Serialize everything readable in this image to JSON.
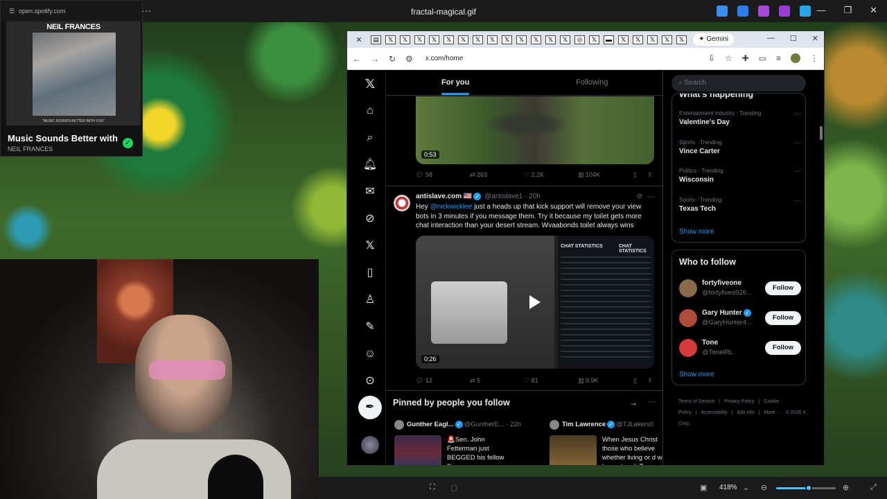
{
  "viewer": {
    "title": "fractal-magical.gif",
    "more": "···",
    "controls": [
      "—",
      "❐",
      "✕"
    ],
    "tray_colors": [
      "#3b8df0",
      "#2b7de9",
      "#a84ad8",
      "#9b3bd6",
      "#2aa4e8"
    ],
    "zoom": "418%"
  },
  "spotify": {
    "url": "open.spotify.com",
    "album_artist_art": "NEIL FRANCES",
    "album_caption": "\"MUSIC SOUNDS BETTER WITH YOU\"",
    "track_title": "Music Sounds Better with",
    "artist": "NEIL FRANCES"
  },
  "browser": {
    "url": "x.com/home",
    "gemini_label": "Gemini",
    "tab_close": "✕",
    "new_tab": "+",
    "tab_count": 22
  },
  "x": {
    "tabs": {
      "for_you": "For you",
      "following": "Following"
    },
    "post1": {
      "video_time": "0:53",
      "replies": "58",
      "reposts": "263",
      "likes": "2.2K",
      "views": "104K"
    },
    "post2": {
      "name": "antislave.com 🇺🇸",
      "handle": "@antislave1",
      "time": "· 20h",
      "text_before": "Hey ",
      "mention": "@nickwicklee",
      "text_after": " just a heads up that kick support will remove your view bots in 3 minutes if you message them. Try it because my toilet gets more chat interaction than your desert stream. Wvaabonds toilet always wins",
      "video_time": "0:26",
      "panel_title_1": "CHAT STATISTICS",
      "panel_title_2": "CHAT STATISTICS",
      "replies": "12",
      "reposts": "5",
      "likes": "81",
      "views": "9.9K"
    },
    "pinned": {
      "title": "Pinned by people you follow",
      "cards": [
        {
          "name": "Gunther Eagl...",
          "handle": "@GuntherE...",
          "time": "· 22h",
          "text": "🚨Sen. John Fetterman just BEGGED his fellow Dems..."
        },
        {
          "name": "Tim Lawrence",
          "handle": "@TJLakers0",
          "time": "",
          "text": "When Jesus Christ those who believe whether living or d will be raptured. T"
        }
      ]
    },
    "search_placeholder": "Search",
    "trends_title": "What's happening",
    "trends": [
      {
        "category": "Entertainment industry · Trending",
        "name": "Valentine's Day"
      },
      {
        "category": "Sports · Trending",
        "name": "Vince Carter"
      },
      {
        "category": "Politics · Trending",
        "name": "Wisconsin"
      },
      {
        "category": "Sports · Trending",
        "name": "Texas Tech"
      }
    ],
    "show_more": "Show more",
    "who_to_follow": "Who to follow",
    "follow_suggestions": [
      {
        "name": "fortyfiveone",
        "handle": "@fortyfiveo926...",
        "button": "Follow",
        "color": "#8a6a4a"
      },
      {
        "name": "Gary Hunter",
        "handle": "@GaryHunter4...",
        "button": "Follow",
        "color": "#b04a3a"
      },
      {
        "name": "Tone",
        "handle": "@ToneIRL",
        "button": "Follow",
        "color": "#d63a3a"
      }
    ],
    "show_more_2": "Show more",
    "footer": [
      "Terms of Service",
      "|",
      "Privacy Policy",
      "|",
      "Cookie Policy",
      "|",
      "Accessibility",
      "|",
      "Ads info",
      "|",
      "More ···",
      "© 2026 X Corp."
    ]
  }
}
